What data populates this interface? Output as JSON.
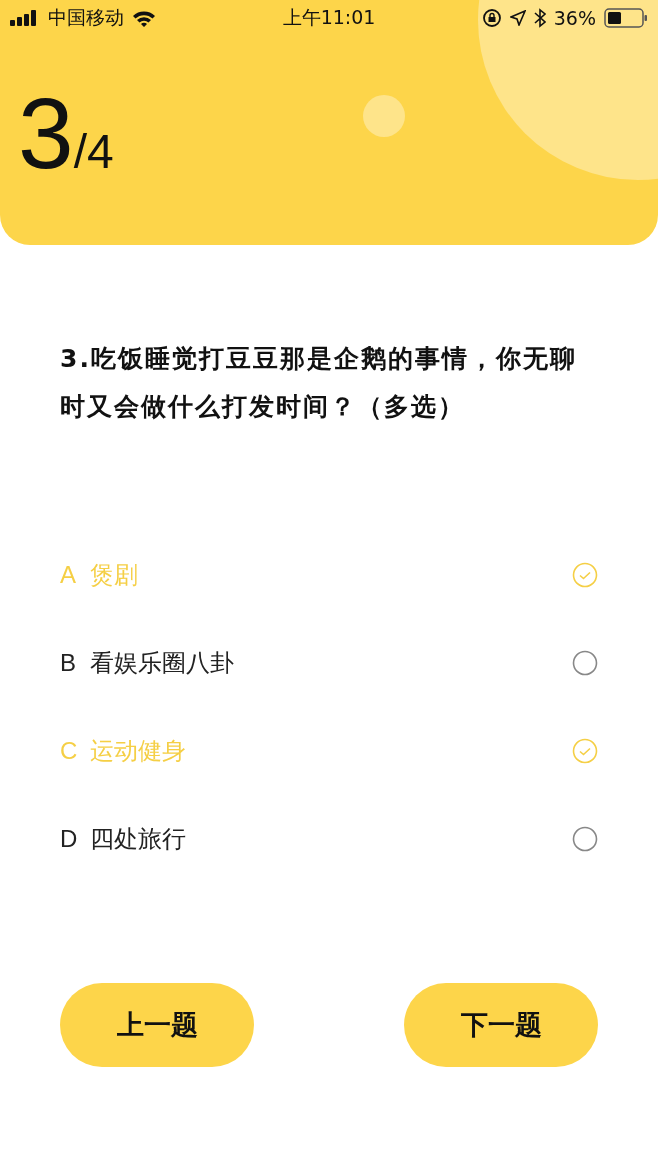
{
  "status_bar": {
    "carrier": "中国移动",
    "time": "上午11:01",
    "battery": "36%"
  },
  "progress": {
    "current": "3",
    "total": "/4"
  },
  "question": "3.吃饭睡觉打豆豆那是企鹅的事情，你无聊时又会做什么打发时间？（多选）",
  "options": [
    {
      "letter": "A",
      "label": "煲剧",
      "checked": true
    },
    {
      "letter": "B",
      "label": "看娱乐圈八卦",
      "checked": false
    },
    {
      "letter": "C",
      "label": "运动健身",
      "checked": true
    },
    {
      "letter": "D",
      "label": "四处旅行",
      "checked": false
    }
  ],
  "buttons": [
    {
      "label": "上一题"
    },
    {
      "label": "下一题"
    }
  ]
}
